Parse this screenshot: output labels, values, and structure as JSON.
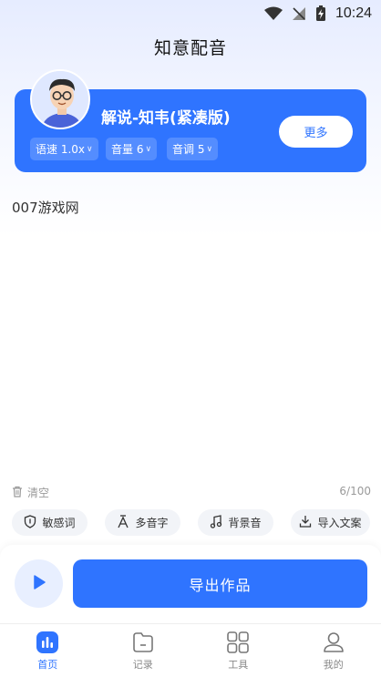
{
  "status_bar": {
    "time": "10:24"
  },
  "app": {
    "title": "知意配音"
  },
  "voice_card": {
    "name": "解说-知韦(紧凑版)",
    "chips": [
      {
        "label": "语速 1.0x"
      },
      {
        "label": "音量 6"
      },
      {
        "label": "音调 5"
      }
    ],
    "more_label": "更多"
  },
  "editor": {
    "text": "007游戏网",
    "clear_label": "清空",
    "char_count": "6/100"
  },
  "tools": [
    {
      "label": "敏感词",
      "icon": "shield-icon"
    },
    {
      "label": "多音字",
      "icon": "text-a-icon"
    },
    {
      "label": "背景音",
      "icon": "music-note-icon"
    },
    {
      "label": "导入文案",
      "icon": "import-icon"
    }
  ],
  "actions": {
    "export_label": "导出作品"
  },
  "tabbar": {
    "items": [
      {
        "label": "首页",
        "icon": "bar-chart-icon",
        "active": true
      },
      {
        "label": "记录",
        "icon": "folder-icon",
        "active": false
      },
      {
        "label": "工具",
        "icon": "grid-icon",
        "active": false
      },
      {
        "label": "我的",
        "icon": "user-icon",
        "active": false
      }
    ]
  },
  "colors": {
    "accent": "#2f74ff",
    "accent_light": "#e8efff"
  }
}
